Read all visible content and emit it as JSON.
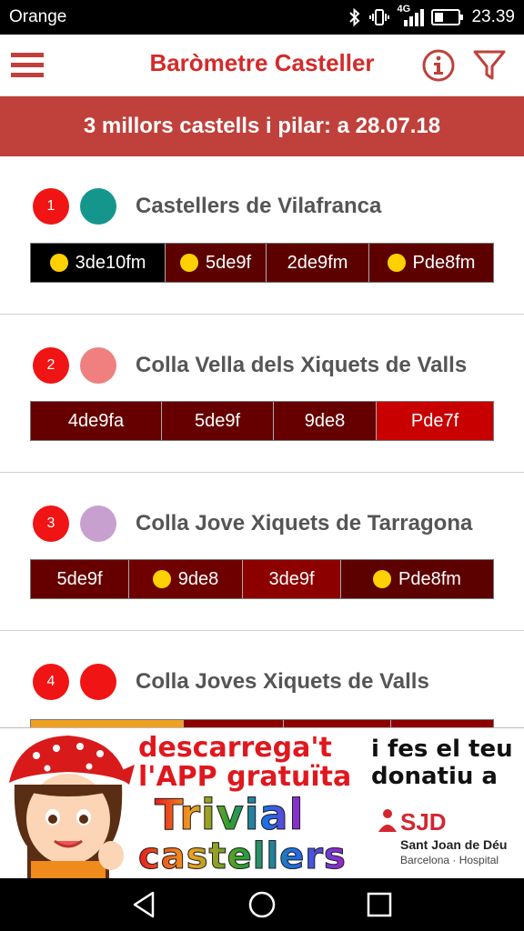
{
  "status_bar": {
    "carrier": "Orange",
    "network": "4G",
    "time": "23.39"
  },
  "app_bar": {
    "title": "Baròmetre Casteller",
    "icons": [
      "menu-icon",
      "info-icon",
      "filter-icon"
    ]
  },
  "banner": {
    "text": "3 millors castells i pilar: a 28.07.18"
  },
  "colors": {
    "brand_red": "#d42a2a",
    "banner_red": "#c0403b",
    "rank_badge": "#f01414",
    "yellow_dot": "#ffd100"
  },
  "teams": [
    {
      "rank": "1",
      "name": "Castellers de Vilafranca",
      "team_color": "#14968c",
      "castells": [
        {
          "label": "3de10fm",
          "dot": true,
          "color": "#000000"
        },
        {
          "label": "5de9f",
          "dot": true,
          "color": "#5c0000"
        },
        {
          "label": "2de9fm",
          "dot": false,
          "color": "#5c0000"
        },
        {
          "label": "Pde8fm",
          "dot": true,
          "color": "#5c0000"
        }
      ]
    },
    {
      "rank": "2",
      "name": "Colla Vella dels Xiquets de Valls",
      "team_color": "#f08080",
      "castells": [
        {
          "label": "4de9fa",
          "dot": false,
          "color": "#660000"
        },
        {
          "label": "5de9f",
          "dot": false,
          "color": "#660000"
        },
        {
          "label": "9de8",
          "dot": false,
          "color": "#660000"
        },
        {
          "label": "Pde7f",
          "dot": false,
          "color": "#c80000"
        }
      ]
    },
    {
      "rank": "3",
      "name": "Colla Jove Xiquets de Tarragona",
      "team_color": "#c8a0d0",
      "castells": [
        {
          "label": "5de9f",
          "dot": false,
          "color": "#660000"
        },
        {
          "label": "9de8",
          "dot": true,
          "color": "#6e0000"
        },
        {
          "label": "3de9f",
          "dot": false,
          "color": "#8c0000"
        },
        {
          "label": "Pde8fm",
          "dot": true,
          "color": "#5c0000"
        }
      ]
    },
    {
      "rank": "4",
      "name": "Colla Joves Xiquets de Valls",
      "team_color": "#f01414",
      "castells": [
        {
          "label": "",
          "dot": false,
          "color": "#f0a020"
        },
        {
          "label": "",
          "dot": false,
          "color": "#8c0000"
        },
        {
          "label": "",
          "dot": false,
          "color": "#8c0000"
        },
        {
          "label": "",
          "dot": false,
          "color": "#8c0000"
        }
      ]
    }
  ],
  "ad": {
    "headline_1": "descarrega't",
    "headline_2": "l'APP gratuïta",
    "product_1": "Trivial",
    "product_2": "castellers",
    "side_1": "i fes el teu",
    "side_2": "donatiu a",
    "logo_text": "SJD",
    "org_name": "Sant Joan de Déu",
    "org_sub": "Barcelona · Hospital"
  },
  "nav_bar": {
    "icons": [
      "back-icon",
      "home-icon",
      "recents-icon"
    ]
  }
}
